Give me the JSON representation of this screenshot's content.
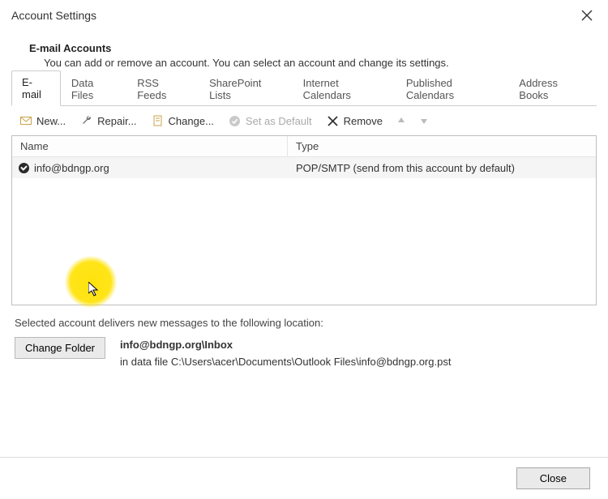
{
  "window": {
    "title": "Account Settings"
  },
  "header": {
    "title": "E-mail Accounts",
    "description": "You can add or remove an account. You can select an account and change its settings."
  },
  "tabs": [
    {
      "label": "E-mail",
      "active": true
    },
    {
      "label": "Data Files",
      "active": false
    },
    {
      "label": "RSS Feeds",
      "active": false
    },
    {
      "label": "SharePoint Lists",
      "active": false
    },
    {
      "label": "Internet Calendars",
      "active": false
    },
    {
      "label": "Published Calendars",
      "active": false
    },
    {
      "label": "Address Books",
      "active": false
    }
  ],
  "toolbar": {
    "new": "New...",
    "repair": "Repair...",
    "change": "Change...",
    "set_default": "Set as Default",
    "remove": "Remove"
  },
  "columns": {
    "name": "Name",
    "type": "Type"
  },
  "accounts": [
    {
      "name": "info@bdngp.org",
      "type": "POP/SMTP (send from this account by default)",
      "is_default": true
    }
  ],
  "delivery": {
    "intro": "Selected account delivers new messages to the following location:",
    "change_folder": "Change Folder",
    "folder_path": "info@bdngp.org\\Inbox",
    "data_file_line": "in data file C:\\Users\\acer\\Documents\\Outlook Files\\info@bdngp.org.pst"
  },
  "footer": {
    "close": "Close"
  }
}
